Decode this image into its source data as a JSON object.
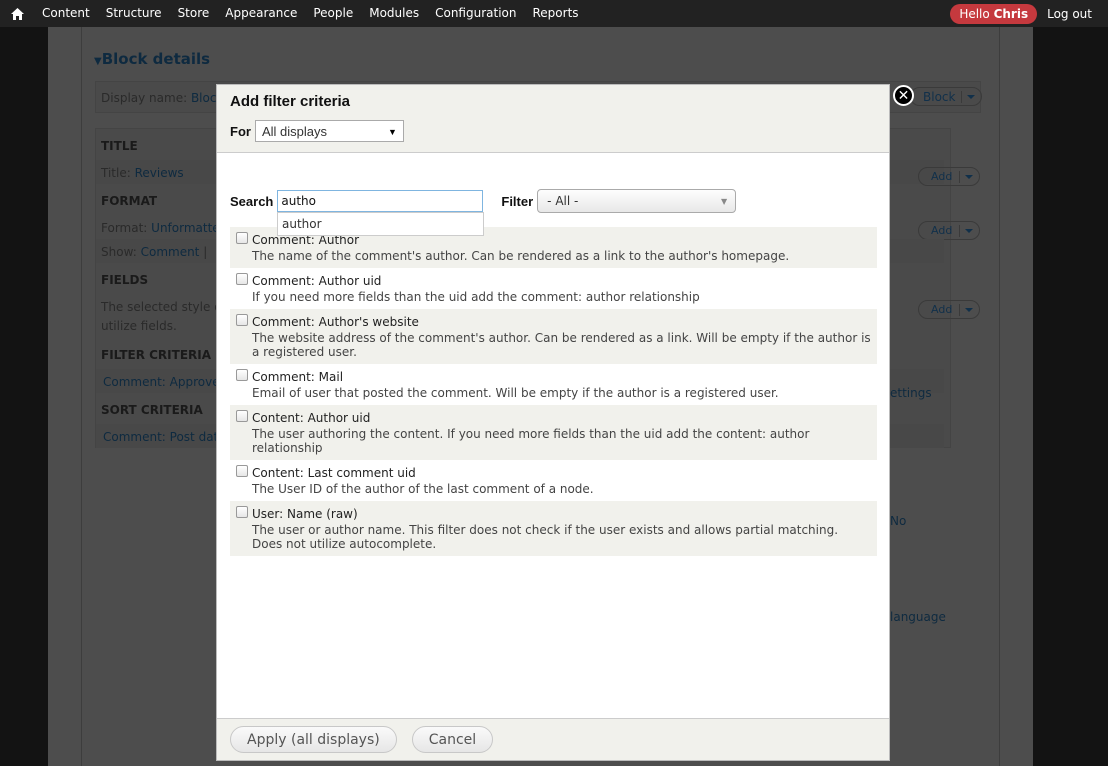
{
  "toolbar": {
    "home_icon": "home-icon",
    "items": [
      "Content",
      "Structure",
      "Store",
      "Appearance",
      "People",
      "Modules",
      "Configuration",
      "Reports"
    ],
    "hello": "Hello",
    "user": "Chris",
    "logout": "Log out"
  },
  "background": {
    "block_details": "Block details",
    "display_name_label": "Display name:",
    "display_name_value": "Block",
    "block_button": "Block",
    "title_heading": "TITLE",
    "title_label": "Title:",
    "title_value": "Reviews",
    "format_heading": "FORMAT",
    "format_label": "Format:",
    "format_value": "Unformatte",
    "show_label": "Show:",
    "show_value": "Comment",
    "show_sep": "|",
    "fields_heading": "FIELDS",
    "fields_text_1": "The selected style o",
    "fields_text_2": "utilize fields.",
    "filter_heading": "FILTER CRITERIA",
    "filter_value": "Comment: Approve",
    "sort_heading": "SORT CRITERIA",
    "sort_value": "Comment: Post dat",
    "add_label": "Add",
    "settings_text": "ettings",
    "no_text": "No",
    "language_text": "language"
  },
  "dialog": {
    "title": "Add filter criteria",
    "for_label": "For",
    "for_value": "All displays",
    "search_label": "Search",
    "search_value": "autho",
    "autocomplete_suggestion": "author",
    "filter_label": "Filter",
    "filter_value": "- All -",
    "options": [
      {
        "title": "Comment: Author",
        "description": "The name of the comment's author. Can be rendered as a link to the author's homepage.",
        "checked": false
      },
      {
        "title": "Comment: Author uid",
        "description": "If you need more fields than the uid add the comment: author relationship",
        "checked": false
      },
      {
        "title": "Comment: Author's website",
        "description": "The website address of the comment's author. Can be rendered as a link. Will be empty if the author is a registered user.",
        "checked": false
      },
      {
        "title": "Comment: Mail",
        "description": "Email of user that posted the comment. Will be empty if the author is a registered user.",
        "checked": false
      },
      {
        "title": "Content: Author uid",
        "description": "The user authoring the content. If you need more fields than the uid add the content: author relationship",
        "checked": false
      },
      {
        "title": "Content: Last comment uid",
        "description": "The User ID of the author of the last comment of a node.",
        "checked": false
      },
      {
        "title": "User: Name (raw)",
        "description": "The user or author name. This filter does not check if the user exists and allows partial matching. Does not utilize autocomplete.",
        "checked": false
      }
    ],
    "apply_label": "Apply (all displays)",
    "cancel_label": "Cancel",
    "close_icon": "close-icon"
  }
}
